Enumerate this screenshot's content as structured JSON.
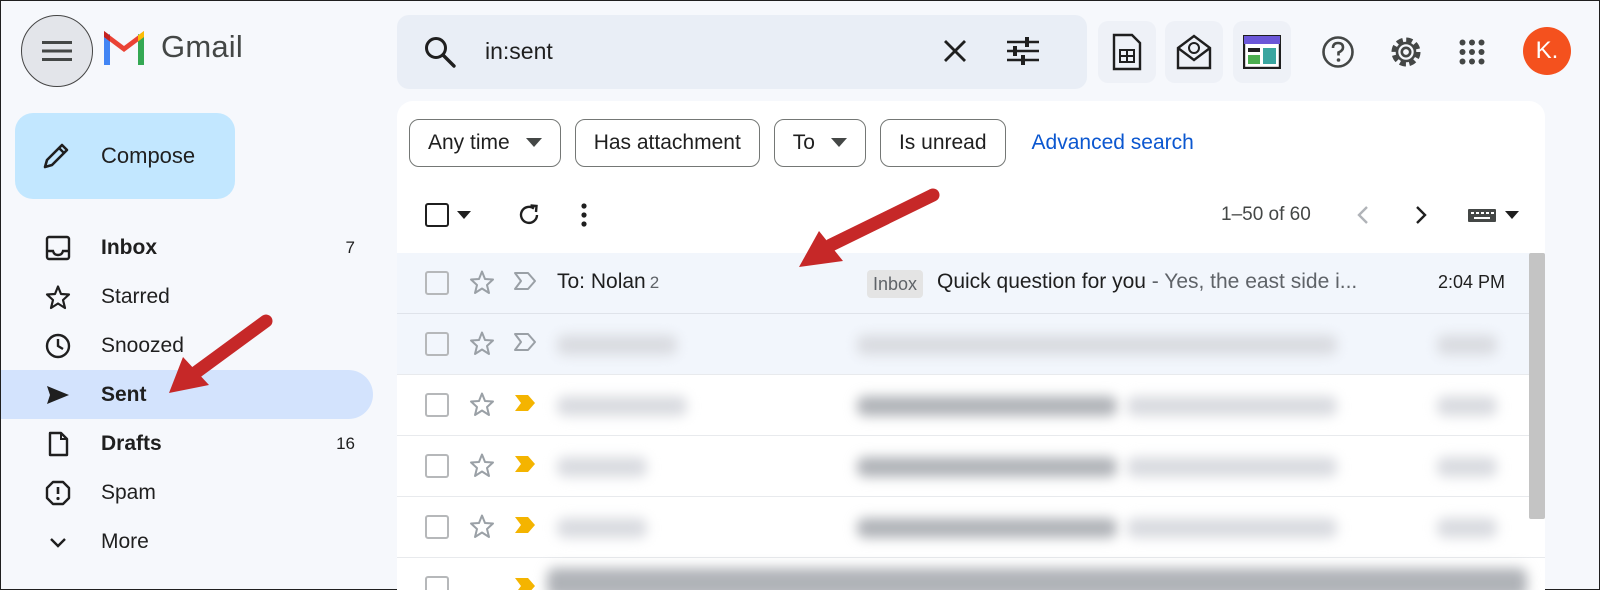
{
  "header": {
    "app_name": "Gmail",
    "search_value": "in:sent",
    "avatar_initial": "K.",
    "icons": [
      "menu-icon",
      "search-icon",
      "clear-icon",
      "search-options-icon",
      "sheets-icon",
      "email-app-icon",
      "layout-app-icon",
      "help-icon",
      "settings-icon",
      "apps-grid-icon"
    ]
  },
  "compose": {
    "label": "Compose"
  },
  "nav": [
    {
      "label": "Inbox",
      "count": "7",
      "icon": "inbox-icon",
      "bold": true,
      "active": false
    },
    {
      "label": "Starred",
      "count": "",
      "icon": "star-icon",
      "bold": false,
      "active": false
    },
    {
      "label": "Snoozed",
      "count": "",
      "icon": "clock-icon",
      "bold": false,
      "active": false
    },
    {
      "label": "Sent",
      "count": "",
      "icon": "send-icon",
      "bold": true,
      "active": true
    },
    {
      "label": "Drafts",
      "count": "16",
      "icon": "draft-icon",
      "bold": true,
      "active": false
    },
    {
      "label": "Spam",
      "count": "",
      "icon": "spam-icon",
      "bold": false,
      "active": false
    },
    {
      "label": "More",
      "count": "",
      "icon": "chevron-down-icon",
      "bold": false,
      "active": false
    }
  ],
  "filters": {
    "any_time": "Any time",
    "has_attachment": "Has attachment",
    "to": "To",
    "is_unread": "Is unread",
    "advanced_search": "Advanced search"
  },
  "toolbar": {
    "pagination": "1–50 of 60"
  },
  "emails": [
    {
      "sender": "To: Nolan",
      "thread_count": "2",
      "label": "Inbox",
      "subject": "Quick question for you",
      "snippet": " - Yes, the east side i...",
      "time": "2:04 PM"
    }
  ],
  "colors": {
    "accent": "#0b57d0",
    "compose_bg": "#c2e7ff",
    "active_nav_bg": "#d3e3fd",
    "avatar_bg": "#f4511e",
    "annotation_arrow": "#c62828",
    "important_marker": "#f4b400"
  }
}
